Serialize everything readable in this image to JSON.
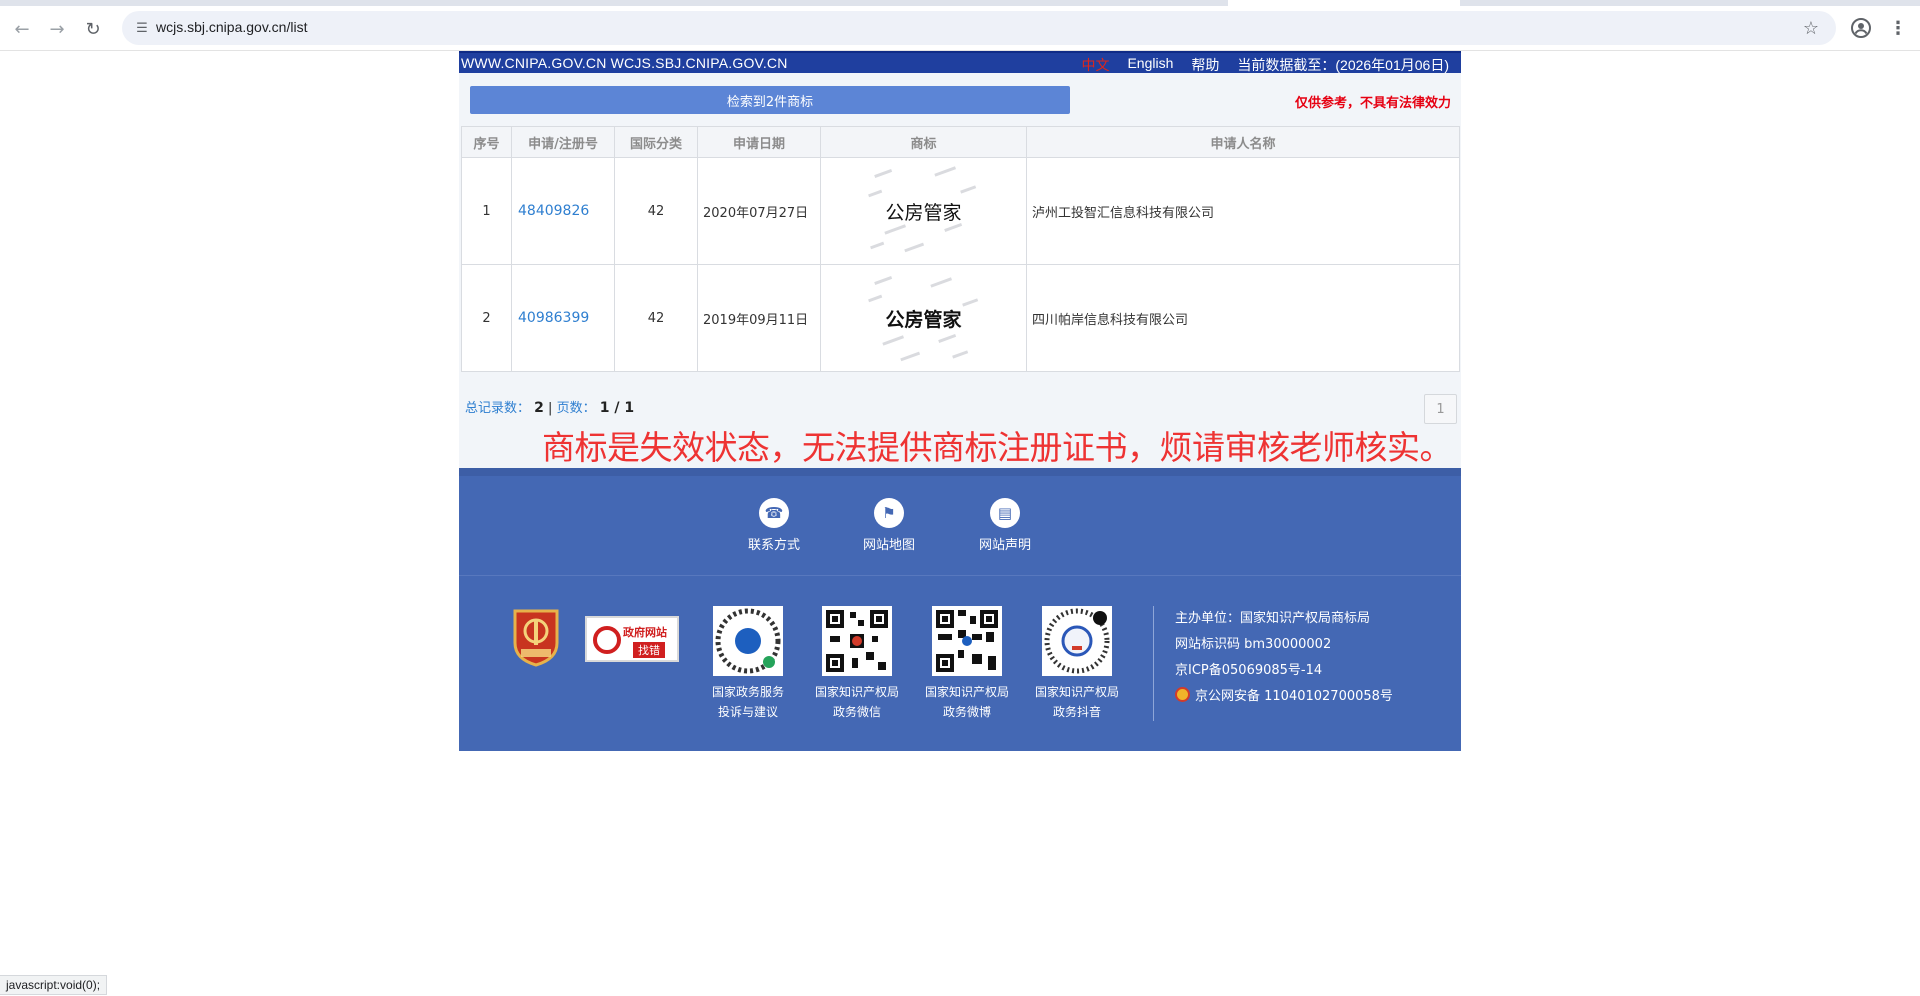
{
  "browser": {
    "url": "wcjs.sbj.cnipa.gov.cn/list",
    "status_text": "javascript:void(0);"
  },
  "topbar": {
    "domains": "WWW.CNIPA.GOV.CN WCJS.SBJ.CNIPA.GOV.CN",
    "lang_zh": "中文",
    "lang_en": "English",
    "help": "帮助",
    "data_cutoff": "当前数据截至：(2026年01月06日)"
  },
  "results": {
    "count_label": "检索到2件商标",
    "disclaimer": "仅供参考，不具有法律效力",
    "headers": [
      "序号",
      "申请/注册号",
      "国际分类",
      "申请日期",
      "商标",
      "申请人名称"
    ],
    "rows": [
      {
        "no": "1",
        "reg_no": "48409826",
        "class": "42",
        "date": "2020年07月27日",
        "mark": "公房管家",
        "applicant": "泸州工投智汇信息科技有限公司"
      },
      {
        "no": "2",
        "reg_no": "40986399",
        "class": "42",
        "date": "2019年09月11日",
        "mark": "公房管家",
        "applicant": "四川帕岸信息科技有限公司"
      }
    ],
    "total_label": "总记录数：",
    "total_value": "2",
    "pages_label": "页数：",
    "pages_value": "1 / 1",
    "page_button": "1"
  },
  "annotation": "商标是失效状态，无法提供商标注册证书，烦请审核老师核实。",
  "footer": {
    "nav": [
      {
        "label": "联系方式",
        "icon": "phone-icon"
      },
      {
        "label": "网站地图",
        "icon": "map-pin-icon"
      },
      {
        "label": "网站声明",
        "icon": "document-icon"
      }
    ],
    "find_error_line1": "政府网站",
    "find_error_line2": "找错",
    "qr": [
      {
        "line1": "国家政务服务",
        "line2": "投诉与建议"
      },
      {
        "line1": "国家知识产权局",
        "line2": "政务微信"
      },
      {
        "line1": "国家知识产权局",
        "line2": "政务微博"
      },
      {
        "line1": "国家知识产权局",
        "line2": "政务抖音"
      }
    ],
    "sponsor": "主办单位：国家知识产权局商标局",
    "site_id": "网站标识码 bm30000002",
    "icp": "京ICP备05069085号-14",
    "police": "京公网安备 11040102700058号"
  },
  "colors": {
    "topbar": "#1f3f9f",
    "count_bar": "#5c85d6",
    "disclaimer": "#e60012",
    "link": "#2f7fd0",
    "annotation": "#ee3333",
    "footer": "#4468b4"
  }
}
